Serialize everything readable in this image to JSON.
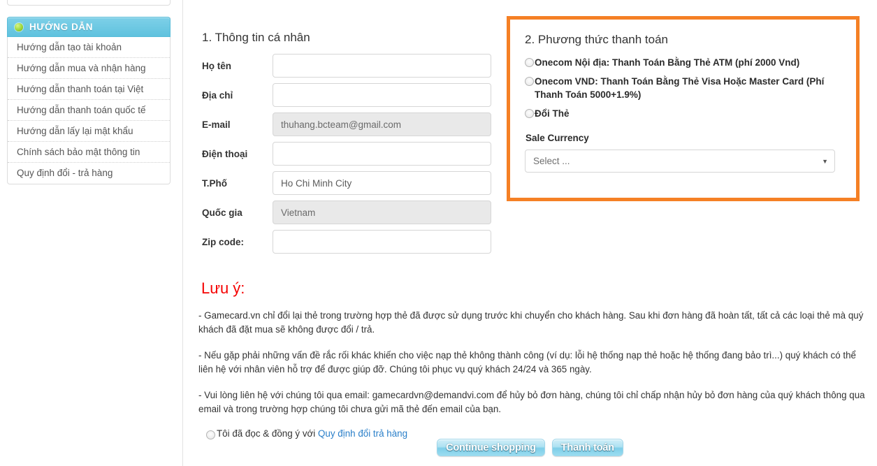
{
  "sidebar": {
    "header": {
      "title": "HƯỚNG DẪN",
      "icon": "green-bullet-icon"
    },
    "items": [
      {
        "label": "Hướng dẫn tạo tài khoản"
      },
      {
        "label": "Hướng dẫn mua và nhận hàng"
      },
      {
        "label": "Hướng dẫn thanh toán tại Việt"
      },
      {
        "label": "Hướng dẫn thanh toán quốc tế"
      },
      {
        "label": "Hướng dẫn lấy lại mật khẩu"
      },
      {
        "label": "Chính sách bảo mật thông tin"
      },
      {
        "label": "Quy định đổi - trả hàng"
      }
    ]
  },
  "personal_info": {
    "title": "1. Thông tin cá nhân",
    "fields": [
      {
        "label": "Họ tên",
        "value": "",
        "placeholder": "",
        "disabled": false
      },
      {
        "label": "Địa chỉ",
        "value": "",
        "placeholder": "",
        "disabled": false
      },
      {
        "label": "E-mail",
        "value": "thuhang.bcteam@gmail.com",
        "placeholder": "",
        "disabled": true
      },
      {
        "label": "Điện thoại",
        "value": "",
        "placeholder": "",
        "disabled": false
      },
      {
        "label": "T.Phố",
        "value": "Ho Chi Minh City",
        "placeholder": "",
        "disabled": false
      },
      {
        "label": "Quốc gia",
        "value": "Vietnam",
        "placeholder": "",
        "disabled": true
      },
      {
        "label": "Zip code:",
        "value": "",
        "placeholder": "",
        "disabled": false
      }
    ]
  },
  "payment": {
    "title": "2. Phương thức thanh toán",
    "border_color": "#f58025",
    "options": [
      {
        "label": "Onecom Nội địa: Thanh Toán Bằng Thẻ ATM (phí 2000 Vnd)",
        "selected": false
      },
      {
        "label": "Onecom VND: Thanh Toán Bằng Thẻ Visa Hoặc Master Card (Phí Thanh Toán 5000+1.9%)",
        "selected": false
      },
      {
        "label": "Đổi Thẻ",
        "selected": false
      }
    ],
    "currency": {
      "label": "Sale Currency",
      "selected": "Select ...",
      "options": [
        "Select ..."
      ],
      "caret": "▼"
    }
  },
  "notes": {
    "heading": "Lưu ý:",
    "paragraphs": [
      "- Gamecard.vn chỉ đổi lại thẻ trong trường hợp thẻ đã được sử dụng trước khi chuyển cho khách hàng. Sau khi đơn hàng đã hoàn tất, tất cả các loại thẻ mà quý khách đã đặt mua sẽ không được đổi / trả.",
      "- Nếu gặp phải những vấn đề rắc rối khác khiến cho việc nạp thẻ không thành công (ví dụ: lỗi hệ thống nạp thẻ hoặc hệ thống đang bảo trì...) quý khách có thể liên hệ với nhân viên hỗ trợ để được giúp đỡ. Chúng tôi phục vụ quý khách 24/24 và 365 ngày.",
      "- Vui lòng liên hệ với chúng tôi qua email: gamecardvn@demandvi.com để hủy bỏ đơn hàng, chúng tôi chỉ chấp nhận hủy bỏ đơn hàng của quý khách thông qua email và trong trường hợp chúng tôi chưa gửi mã thẻ đến email của bạn."
    ],
    "agreement": {
      "text": "Tôi đã đọc & đồng ý với ",
      "link_text": "Quy định đổi trả hàng",
      "link_color": "#2a7fc9",
      "checked": false
    }
  },
  "buttons": {
    "continue_label": "Continue shopping",
    "pay_label": "Thanh toán"
  }
}
